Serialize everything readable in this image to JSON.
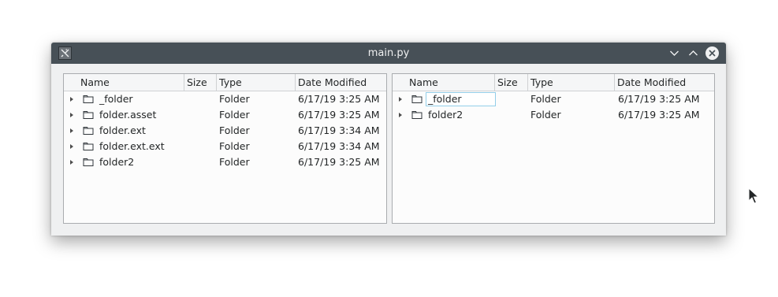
{
  "window": {
    "title": "main.py",
    "buttons": {
      "minimize": "chevron-down-icon",
      "maximize": "chevron-up-icon",
      "close": "close-icon"
    }
  },
  "columns": [
    "Name",
    "Size",
    "Type",
    "Date Modified"
  ],
  "left_panel": {
    "rows": [
      {
        "name": "_folder",
        "size": "",
        "type": "Folder",
        "date": "6/17/19 3:25 AM"
      },
      {
        "name": "folder.asset",
        "size": "",
        "type": "Folder",
        "date": "6/17/19 3:25 AM"
      },
      {
        "name": "folder.ext",
        "size": "",
        "type": "Folder",
        "date": "6/17/19 3:34 AM"
      },
      {
        "name": "folder.ext.ext",
        "size": "",
        "type": "Folder",
        "date": "6/17/19 3:34 AM"
      },
      {
        "name": "folder2",
        "size": "",
        "type": "Folder",
        "date": "6/17/19 3:25 AM"
      }
    ]
  },
  "right_panel": {
    "rows": [
      {
        "name": "_folder",
        "size": "",
        "type": "Folder",
        "date": "6/17/19 3:25 AM",
        "editing": true
      },
      {
        "name": "folder2",
        "size": "",
        "type": "Folder",
        "date": "6/17/19 3:25 AM"
      }
    ]
  },
  "colors": {
    "titlebar": "#475057",
    "window": "#eff0f1",
    "edit_border": "#93cee9"
  }
}
